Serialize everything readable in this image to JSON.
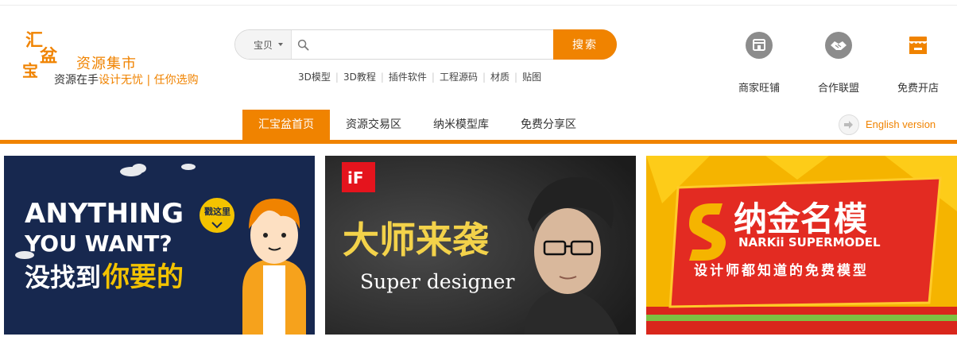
{
  "logo": {
    "mark_chars": [
      "汇",
      "盆",
      "宝"
    ],
    "title": "资源集市",
    "tagline_part1": "资源在手",
    "tagline_part2": "设计无忧 | 任你选购"
  },
  "search": {
    "type_label": "宝贝",
    "placeholder": "",
    "value": "",
    "button_label": "搜索"
  },
  "hot_links": [
    "3D模型",
    "3D教程",
    "插件软件",
    "工程源码",
    "材质",
    "贴图"
  ],
  "shortcuts": [
    {
      "label": "商家旺铺",
      "icon": "shop-icon"
    },
    {
      "label": "合作联盟",
      "icon": "handshake-icon"
    },
    {
      "label": "免费开店",
      "icon": "store-icon"
    }
  ],
  "nav": {
    "items": [
      "汇宝盆首页",
      "资源交易区",
      "纳米模型库",
      "免费分享区"
    ],
    "active_index": 0,
    "english_link": "English version"
  },
  "banners": [
    {
      "title_line1": "ANYTHING",
      "title_line2": "YOU WANT?",
      "title_cn_part1": "没找到",
      "title_cn_part2": "你要的",
      "badge": "戳这里"
    },
    {
      "badge": "iF",
      "title_cn": "大师来袭",
      "subtitle": "Super designer"
    },
    {
      "brand_cn": "纳金名模",
      "brand_en": "NARKii SUPERMODEL",
      "tagline": "设计师都知道的免费模型"
    }
  ],
  "colors": {
    "accent": "#f08300",
    "nav_text": "#333333",
    "icon_gray": "#8c8c8c",
    "banner_navy": "#17284f"
  }
}
